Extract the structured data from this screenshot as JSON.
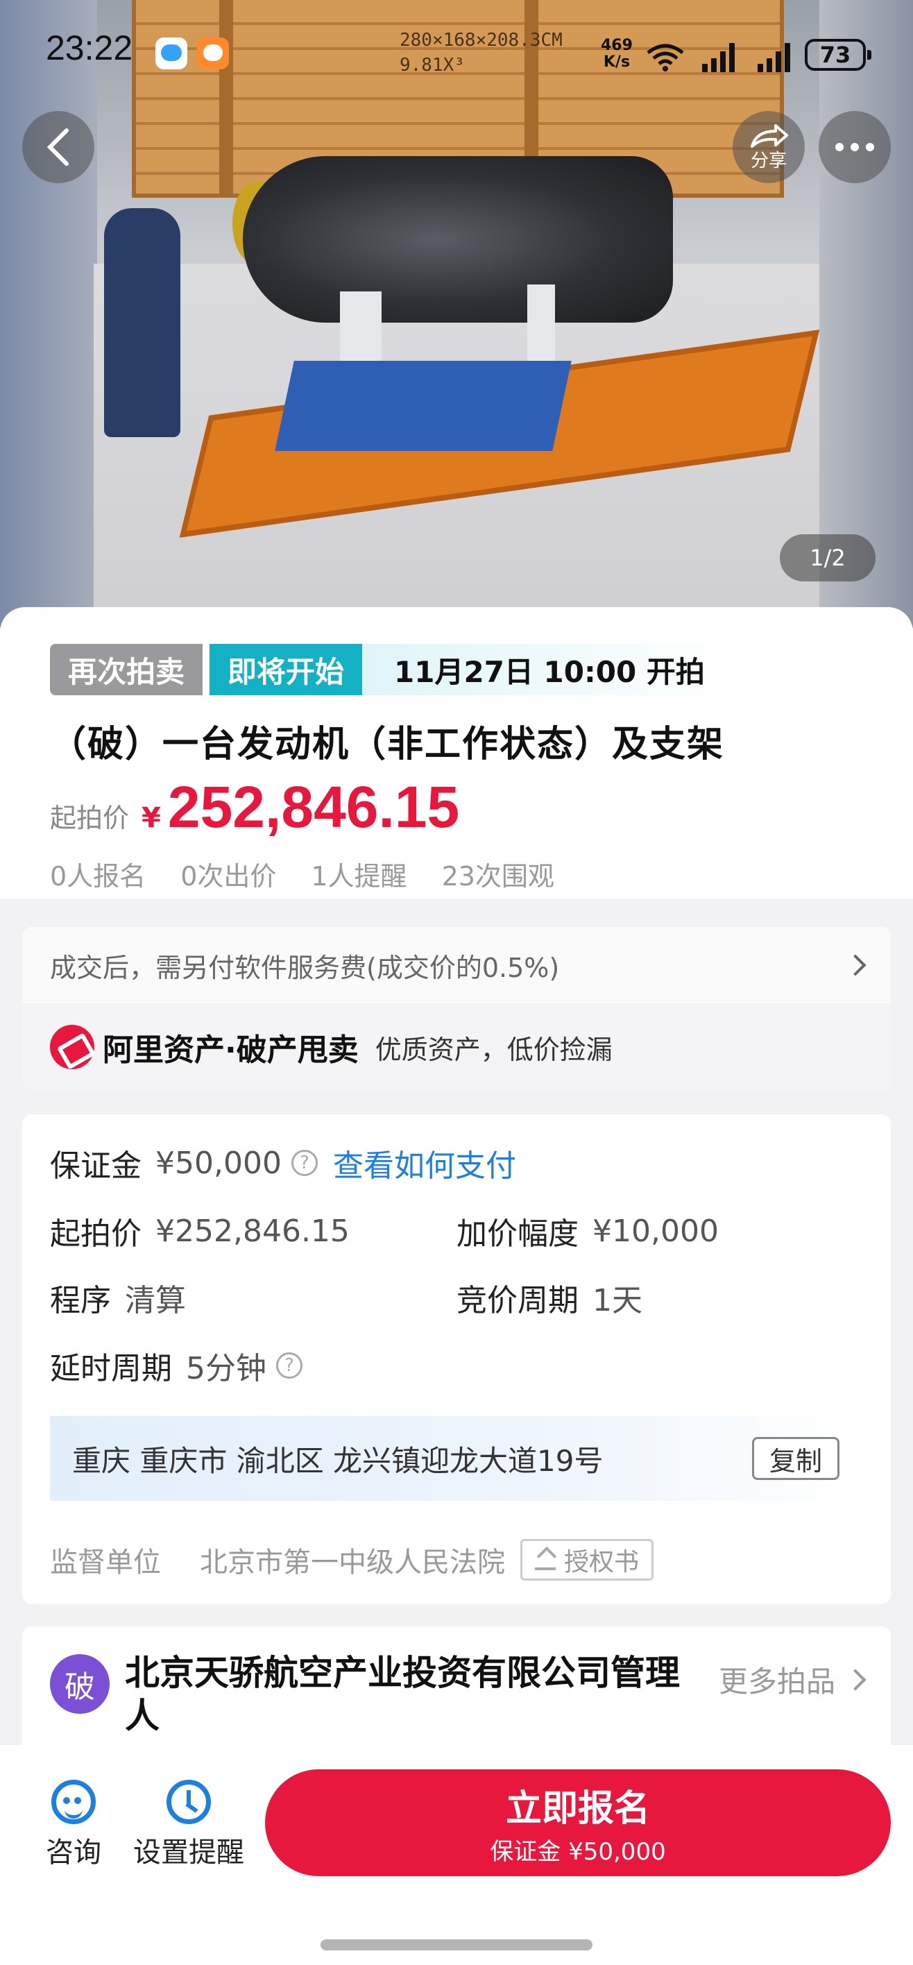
{
  "status_bar": {
    "time": "23:22",
    "net_speed_value": "469",
    "net_speed_unit": "K/s",
    "battery": "73"
  },
  "hero": {
    "image_counter": "1/2",
    "crate_text_line1": "280×168×208.3CM",
    "crate_text_line2": "9.81X³",
    "share_label": "分享"
  },
  "auction": {
    "tag_reauction": "再次拍卖",
    "tag_upcoming": "即将开始",
    "start_time": "11月27日 10:00 开拍",
    "title": "（破）一台发动机（非工作状态）及支架",
    "start_price_label": "起拍价",
    "currency": "¥",
    "start_price": "252,846.15",
    "stats": [
      "0人报名",
      "0次出价",
      "1人提醒",
      "23次围观"
    ]
  },
  "fee": {
    "text": "成交后，需另付软件服务费(成交价的0.5%)",
    "promo_name": "阿里资产·破产甩卖",
    "promo_slogan": "优质资产，低价捡漏"
  },
  "details": {
    "deposit_label": "保证金",
    "deposit_value": "¥50,000",
    "pay_link": "查看如何支付",
    "start_price_label": "起拍价",
    "start_price_value": "¥252,846.15",
    "increment_label": "加价幅度",
    "increment_value": "¥10,000",
    "procedure_label": "程序",
    "procedure_value": "清算",
    "bid_period_label": "竞价周期",
    "bid_period_value": "1天",
    "delay_label": "延时周期",
    "delay_value": "5分钟",
    "address": "重庆 重庆市 渝北区 龙兴镇迎龙大道19号",
    "copy_label": "复制",
    "supervisor_label": "监督单位",
    "supervisor_value": "北京市第一中级人民法院",
    "auth_label": "授权书"
  },
  "manager": {
    "badge": "破",
    "name": "北京天骄航空产业投资有限公司管理人",
    "more_label": "更多拍品"
  },
  "bottom_bar": {
    "consult_label": "咨询",
    "reminder_label": "设置提醒",
    "signup_label": "立即报名",
    "signup_sub": "保证金 ¥50,000"
  },
  "colors": {
    "accent_red": "#e8173d",
    "link_blue": "#1d7fe0",
    "tag_teal": "#14b0c3",
    "tag_grey": "#9a9a9c",
    "manager_purple": "#7b4fd6"
  },
  "icons": [
    "back-icon",
    "share-icon",
    "more-icon",
    "question-icon",
    "chevron-right-icon",
    "upload-icon",
    "chat-icon",
    "alarm-clock-icon",
    "wifi-icon",
    "signal-icon",
    "battery-icon"
  ]
}
